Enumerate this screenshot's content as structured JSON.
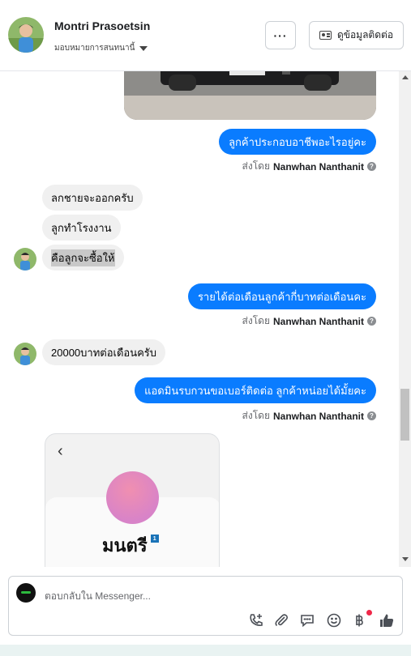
{
  "header": {
    "contact_name": "Montri Prasoetsin",
    "assign_label": "มอบหมายการสนทนานี้",
    "more_label": "···",
    "contact_info_label": "ดูข้อมูลติดต่อ"
  },
  "messages": {
    "m1": "ลูกค้าประกอบอาชีพอะไรอยู่คะ",
    "m2": "ลกชายจะออกครับ",
    "m3": "ลูกทำโรงงาน",
    "m4": "คือลูกจะซื้อให้",
    "m5": "รายได้ต่อเดือนลูกค้ากี่บาทต่อเดือนคะ",
    "m6": "20000บาทต่อเดือนครับ",
    "m7": "แอดมินรบกวนขอเบอร์ติดต่อ ลูกค้าหน่อยได้มั้ยคะ"
  },
  "sent_by": {
    "prefix": "ส่งโดย",
    "agent": "Nanwhan Nanthanit",
    "help": "?"
  },
  "profile_card": {
    "back": "‹",
    "name": "มนตรี",
    "badge": "1"
  },
  "composer": {
    "placeholder": "ตอบกลับใน Messenger..."
  },
  "colors": {
    "outgoing_bubble": "#0a7cff",
    "incoming_bubble": "#f0f0f0",
    "notification_dot": "#f02849"
  },
  "icons": {
    "call": "phone-plus-icon",
    "attach": "paperclip-icon",
    "saved_replies": "chat-bubble-icon",
    "emoji": "smiley-icon",
    "payment": "baht-icon",
    "like": "thumbs-up-icon"
  }
}
